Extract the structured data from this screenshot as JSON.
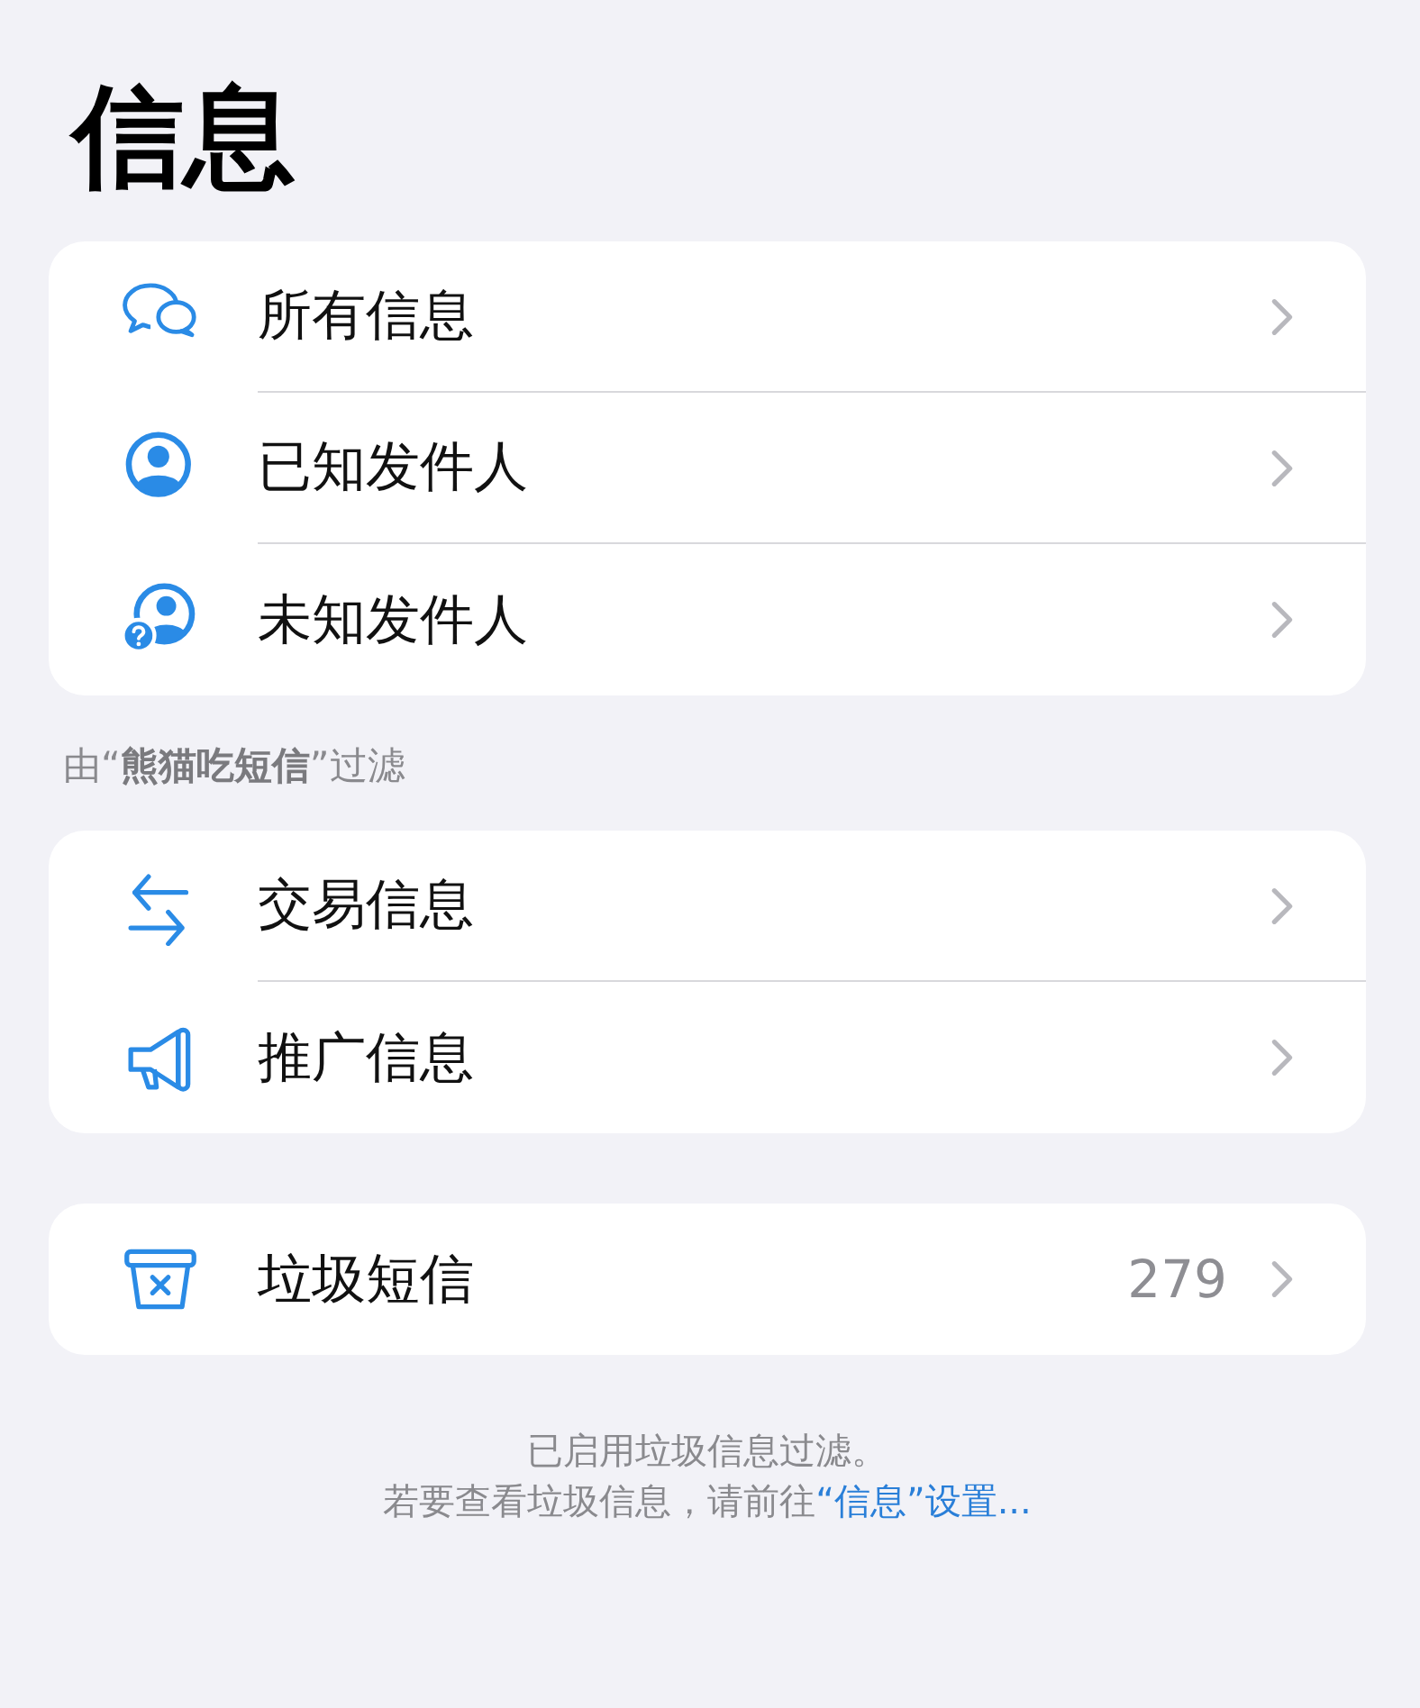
{
  "title": "信息",
  "groups": [
    {
      "items": [
        {
          "label": "所有信息"
        },
        {
          "label": "已知发件人"
        },
        {
          "label": "未知发件人"
        }
      ]
    },
    {
      "header": "由“**熊猫吃短信**”过滤",
      "items": [
        {
          "label": "交易信息"
        },
        {
          "label": "推广信息"
        }
      ]
    },
    {
      "items": [
        {
          "label": "垃圾短信",
          "count": "279"
        }
      ]
    }
  ],
  "footer": {
    "line": "已启用垃圾信息过滤。",
    "text": "若要查看垃圾信息，请前往",
    "link": "“信息”设置..."
  }
}
